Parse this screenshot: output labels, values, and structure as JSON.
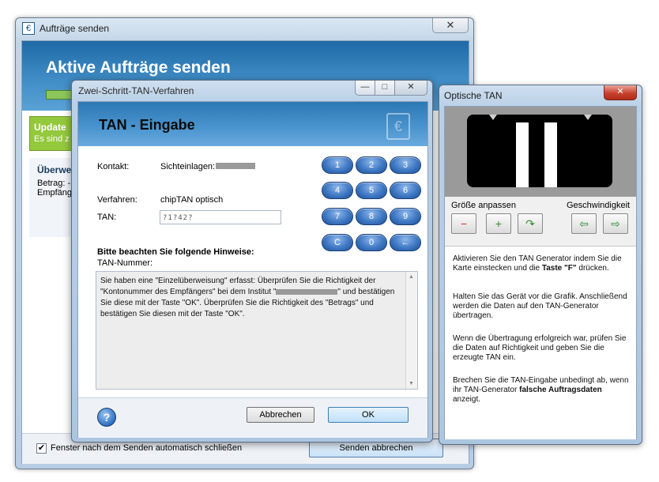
{
  "main_window": {
    "title": "Aufträge senden",
    "close_glyph": "✕",
    "header_title": "Aktive Aufträge senden",
    "update_title": "Update",
    "update_text": "Es sind z",
    "panel_title": "Überwe",
    "panel_line1": "Betrag: -",
    "panel_line2": "Empfäng",
    "autoclose_label": "Fenster nach dem Senden automatisch schließen",
    "autoclose_checked": "✔",
    "send_cancel_label": "Senden abbrechen"
  },
  "tan_dialog": {
    "title": "Zwei-Schritt-TAN-Verfahren",
    "header_title": "TAN - Eingabe",
    "caption_min": "—",
    "caption_max": "□",
    "caption_close": "✕",
    "logo_glyph": "€",
    "contact_label": "Kontakt:",
    "contact_value": "Sichteinlagen:",
    "method_label": "Verfahren:",
    "method_value": "chipTAN optisch",
    "tan_label": "TAN:",
    "tan_value": "?1?42?",
    "keypad": [
      "1",
      "2",
      "3",
      "4",
      "5",
      "6",
      "7",
      "8",
      "9",
      "C",
      "0",
      "←"
    ],
    "hint_title": "Bitte beachten Sie folgende Hinweise:",
    "hint_sub": "TAN-Nummer:",
    "hint_text_a": "Sie haben eine \"Einzelüberweisung\" erfasst: Überprüfen Sie die Richtigkeit der \"Kontonummer des Empfängers\" bei dem Institut \"",
    "hint_text_b": "\" und bestätigen Sie diese mit der Taste \"OK\". Überprüfen Sie die Richtigkeit des \"Betrags\" und bestätigen Sie diesen mit der Taste \"OK\".",
    "help_glyph": "?",
    "cancel_label": "Abbrechen",
    "ok_label": "OK"
  },
  "optical_window": {
    "title": "Optische TAN",
    "close_glyph": "✕",
    "size_label": "Größe anpassen",
    "speed_label": "Geschwindigkeit",
    "tools": [
      {
        "name": "zoom-out-icon",
        "glyph": "−"
      },
      {
        "name": "zoom-in-icon",
        "glyph": "+"
      },
      {
        "name": "redo-icon",
        "glyph": "↷"
      },
      {
        "name": "slower-arrow-icon",
        "glyph": "⇦"
      },
      {
        "name": "faster-arrow-icon",
        "glyph": "⇨"
      }
    ],
    "p1_a": "Aktivieren Sie den TAN Generator indem Sie die Karte einstecken und die ",
    "p1_b": "Taste \"F\"",
    "p1_c": " drücken.",
    "p2": "Halten Sie das Gerät vor die Grafik. Anschließend werden die Daten auf den TAN-Generator übertragen.",
    "p3": "Wenn die Übertragung erfolgreich war, prüfen Sie die Daten auf Richtigkeit und geben Sie die erzeugte TAN ein.",
    "p4_a": "Brechen Sie die TAN-Eingabe unbedingt ab, wenn ihr TAN-Generator ",
    "p4_b": "falsche Auftragsdaten",
    "p4_c": " anzeigt."
  },
  "colors": {
    "header_blue": "#2c78b4",
    "update_green": "#94c83d",
    "keypad_blue": "#3f78c4",
    "close_red": "#c8432f"
  }
}
